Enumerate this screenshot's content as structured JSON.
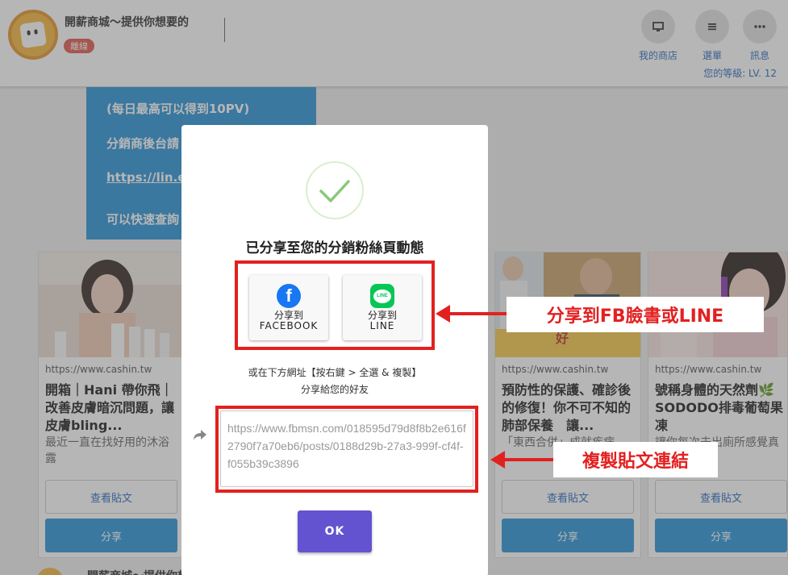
{
  "header": {
    "shop_name": "開薪商城～提供你想要的",
    "status_badge": "離線",
    "nav": [
      {
        "label": "我的商店",
        "icon": "monitor-icon"
      },
      {
        "label": "選單",
        "icon": "menu-icon"
      },
      {
        "label": "訊息",
        "icon": "more-icon"
      }
    ],
    "level": "您的等級: LV. 12"
  },
  "info_panel": {
    "line1": "(每日最高可以得到10PV)",
    "line2": "分銷商後台請",
    "line3": "https://lin.ee",
    "line4": "可以快速查詢"
  },
  "cards": [
    {
      "url": "https://www.cashin.tw",
      "title": "開箱｜Hani 帶你飛｜改善皮膚暗沉問題，讓皮膚bling...",
      "desc": "最近一直在找好用的沐浴露",
      "view": "查看貼文",
      "share": "分享"
    },
    {
      "url": "https://www.cashin.tw",
      "title": "預防性的保護、確診後的修復！你不可不知的肺部保養　讓...",
      "desc": "「東西合併」成就疾病",
      "view": "查看貼文",
      "share": "分享"
    },
    {
      "url": "https://www.cashin.tw",
      "title": "號稱身體的天然劑🌿SODODO排毒葡萄果凍",
      "desc": "讓你每次去出廁所感覺真",
      "view": "查看貼文",
      "share": "分享"
    }
  ],
  "bottom_partial": "開薪商城～提供你想",
  "modal": {
    "title": "已分享至您的分銷粉絲頁動態",
    "fb": {
      "line1": "分享到",
      "line2": "FACEBOOK"
    },
    "line": {
      "line1": "分享到",
      "line2": "LINE",
      "logo_text": "LINE"
    },
    "hint1": "或在下方網址【按右鍵 > 全選 & 複製】",
    "hint2": "分享給您的好友",
    "link": "https://www.fbmsn.com/018595d79d8f8b2e616f2790f7a70eb6/posts/0188d29b-27a3-999f-cf4f-f055b39c3896",
    "ok": "OK"
  },
  "annotations": {
    "share_label": "分享到FB臉書或LINE",
    "copy_label": "複製貼文連結"
  },
  "colors": {
    "accent": "#2b95d8",
    "ok_button": "#6353d0",
    "annotation": "#e32020",
    "badge": "#e05a4e"
  }
}
